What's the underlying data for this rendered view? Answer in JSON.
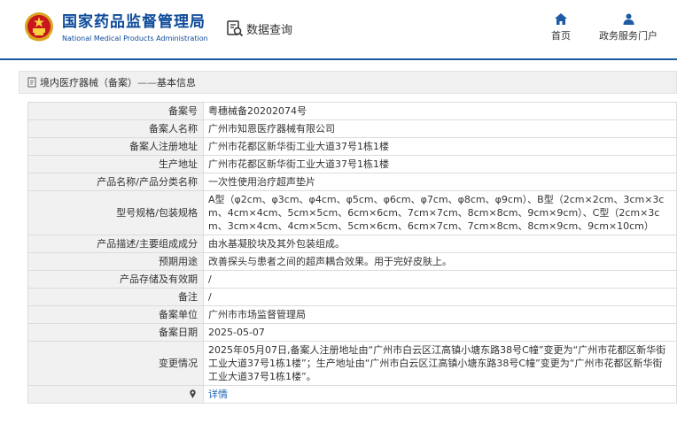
{
  "header": {
    "brand_cn": "国家药品监督管理局",
    "brand_en": "National Medical Products Administration",
    "query_label": "数据查询",
    "nav": {
      "home": "首页",
      "portal": "政务服务门户"
    }
  },
  "breadcrumb": {
    "section": "境内医疗器械（备案）",
    "separator": "——",
    "current": "基本信息"
  },
  "record": {
    "rows": [
      {
        "label": "备案号",
        "value": "粤穗械备20202074号"
      },
      {
        "label": "备案人名称",
        "value": "广州市知恩医疗器械有限公司"
      },
      {
        "label": "备案人注册地址",
        "value": "广州市花都区新华街工业大道37号1栋1楼"
      },
      {
        "label": "生产地址",
        "value": "广州市花都区新华街工业大道37号1栋1楼"
      },
      {
        "label": "产品名称/产品分类名称",
        "value": "一次性使用治疗超声垫片"
      },
      {
        "label": "型号规格/包装规格",
        "value": "A型（φ2cm、φ3cm、φ4cm、φ5cm、φ6cm、φ7cm、φ8cm、φ9cm）、B型（2cm×2cm、3cm×3cm、4cm×4cm、5cm×5cm、6cm×6cm、7cm×7cm、8cm×8cm、9cm×9cm）、C型（2cm×3cm、3cm×4cm、4cm×5cm、5cm×6cm、6cm×7cm、7cm×8cm、8cm×9cm、9cm×10cm）"
      },
      {
        "label": "产品描述/主要组成成分",
        "value": "由水基凝胶块及其外包装组成。"
      },
      {
        "label": "预期用途",
        "value": "改善探头与患者之间的超声耦合效果。用于完好皮肤上。"
      },
      {
        "label": "产品存储及有效期",
        "value": "/"
      },
      {
        "label": "备注",
        "value": "/"
      },
      {
        "label": "备案单位",
        "value": "广州市市场监督管理局"
      },
      {
        "label": "备案日期",
        "value": "2025-05-07"
      },
      {
        "label": "变更情况",
        "value": "2025年05月07日,备案人注册地址由“广州市白云区江高镇小塘东路38号C幢”变更为“广州市花都区新华街工业大道37号1栋1楼”；生产地址由“广州市白云区江高镇小塘东路38号C幢”变更为“广州市花都区新华街工业大道37号1栋1楼”。"
      }
    ],
    "detail_link": "详情"
  },
  "colors": {
    "brand_blue": "#0d4a9a",
    "link_blue": "#1f64b4",
    "label_bg": "#f1f1f1",
    "border": "#dcdcdc"
  },
  "icons": {
    "emblem": "national-emblem-icon",
    "query": "search-document-icon",
    "home": "home-icon",
    "portal": "user-icon",
    "breadcrumb": "document-icon",
    "detail": "map-pin-icon"
  }
}
